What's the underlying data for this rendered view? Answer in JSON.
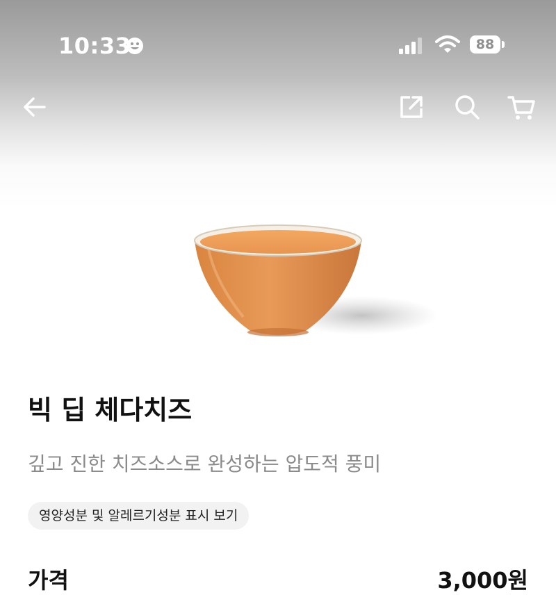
{
  "status_bar": {
    "time": "10:33",
    "face_icon": "smiley-face-icon",
    "signal_icon": "cellular-signal-icon",
    "wifi_icon": "wifi-icon",
    "battery_level": "88"
  },
  "nav": {
    "back_icon": "arrow-left-icon",
    "share_icon": "share-icon",
    "search_icon": "search-icon",
    "cart_icon": "cart-icon"
  },
  "product": {
    "image": "cheese-sauce-bowl-image",
    "name": "빅 딥 체다치즈",
    "description": "깊고 진한 치즈소스로 완성하는 압도적 풍미",
    "nutrition_link": "영양성분 및 알레르기성분 표시 보기",
    "price_label": "가격",
    "price": "3,000원"
  },
  "colors": {
    "sauce": "#e3924f",
    "text_primary": "#111111",
    "text_secondary": "#8a8a8a",
    "chip_bg": "#f2f2f2"
  }
}
